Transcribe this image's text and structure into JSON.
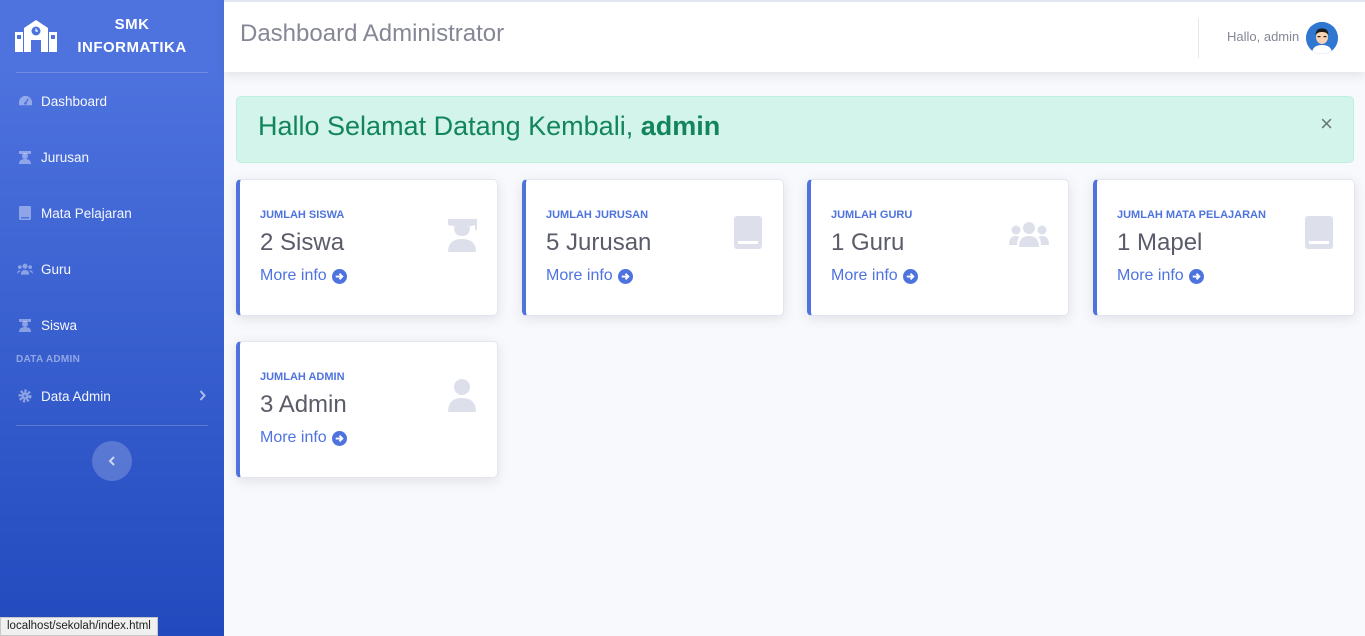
{
  "brand": {
    "line1": "SMK",
    "line2": "INFORMATIKA"
  },
  "sidebar": {
    "items": [
      {
        "label": "Dashboard",
        "icon": "dashboard-icon"
      },
      {
        "label": "Jurusan",
        "icon": "graduate-icon"
      },
      {
        "label": "Mata Pelajaran",
        "icon": "book-icon"
      },
      {
        "label": "Guru",
        "icon": "users-icon"
      },
      {
        "label": "Siswa",
        "icon": "graduate-icon"
      }
    ],
    "heading": "DATA ADMIN",
    "admin_item": {
      "label": "Data Admin",
      "icon": "gear-icon"
    }
  },
  "topbar": {
    "title": "Dashboard Administrator",
    "user_greeting": "Hallo, admin"
  },
  "alert": {
    "text": "Hallo Selamat Datang Kembali, ",
    "username": "admin",
    "close": "×"
  },
  "cards": [
    {
      "label": "JUMLAH SISWA",
      "value": "2 Siswa",
      "link": "More info",
      "icon": "graduate-icon"
    },
    {
      "label": "JUMLAH JURUSAN",
      "value": "5 Jurusan",
      "link": "More info",
      "icon": "book-icon"
    },
    {
      "label": "JUMLAH GURU",
      "value": "1 Guru",
      "link": "More info",
      "icon": "users-icon"
    },
    {
      "label": "JUMLAH MATA PELAJARAN",
      "value": "1 Mapel",
      "link": "More info",
      "icon": "book-icon"
    },
    {
      "label": "JUMLAH ADMIN",
      "value": "3 Admin",
      "link": "More info",
      "icon": "user-icon"
    }
  ],
  "status_url": "localhost/sekolah/index.html",
  "colors": {
    "primary": "#4e73df",
    "sidebar_bottom": "#224abe",
    "alert_bg": "#d2f4ea",
    "alert_text": "#13855c"
  }
}
